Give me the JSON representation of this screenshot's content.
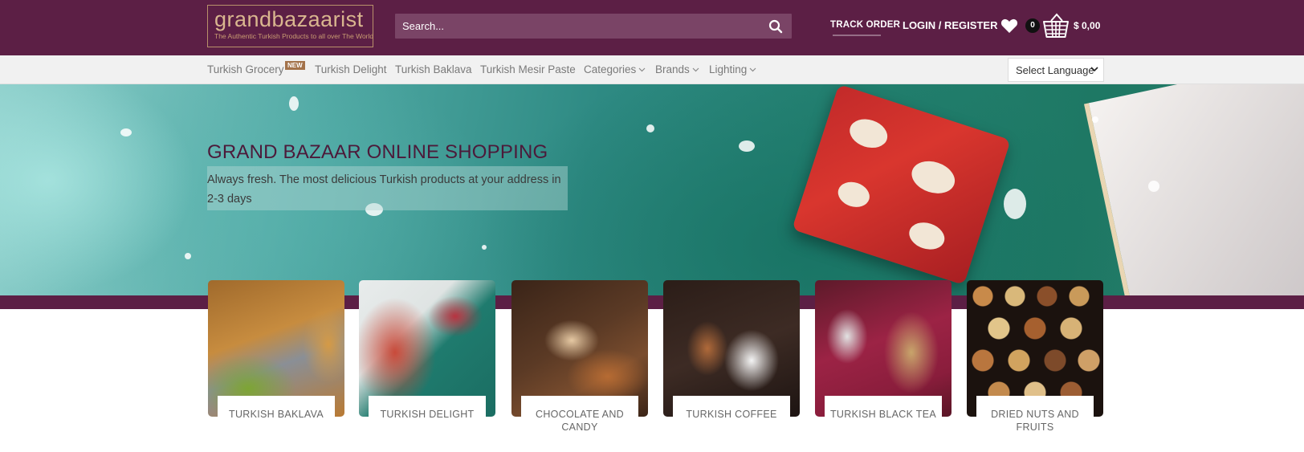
{
  "header": {
    "logo_name": "grandbazaarist",
    "logo_tagline": "The Authentic Turkish Products to all over The World",
    "search_placeholder": "Search...",
    "track_order": "TRACK ORDER",
    "login_register": "LOGIN / REGISTER",
    "cart_count": "0",
    "cart_total": "$ 0,00"
  },
  "nav": {
    "items": [
      {
        "label": "Turkish Grocery",
        "badge": "NEW"
      },
      {
        "label": "Turkish Delight"
      },
      {
        "label": "Turkish Baklava"
      },
      {
        "label": "Turkish Mesir Paste"
      },
      {
        "label": "Categories",
        "dropdown": true
      },
      {
        "label": "Brands",
        "dropdown": true
      },
      {
        "label": "Lighting",
        "dropdown": true
      }
    ],
    "language_select": "Select Language"
  },
  "hero": {
    "title": "GRAND BAZAAR ONLINE SHOPPING",
    "subtitle": "Always fresh. The most delicious Turkish products at your address in 2-3 days"
  },
  "categories": [
    {
      "label": "TURKISH BAKLAVA"
    },
    {
      "label": "TURKISH DELIGHT"
    },
    {
      "label": "CHOCOLATE AND CANDY"
    },
    {
      "label": "TURKISH COFFEE"
    },
    {
      "label": "TURKISH BLACK TEA"
    },
    {
      "label": "DRIED NUTS AND FRUITS"
    }
  ],
  "colors": {
    "brand_maroon": "#5c1f45",
    "logo_gold": "#d9b68f",
    "badge": "#a3724a"
  },
  "icons": [
    "search-icon",
    "heart-icon",
    "basket-icon",
    "chevron-down-icon"
  ]
}
